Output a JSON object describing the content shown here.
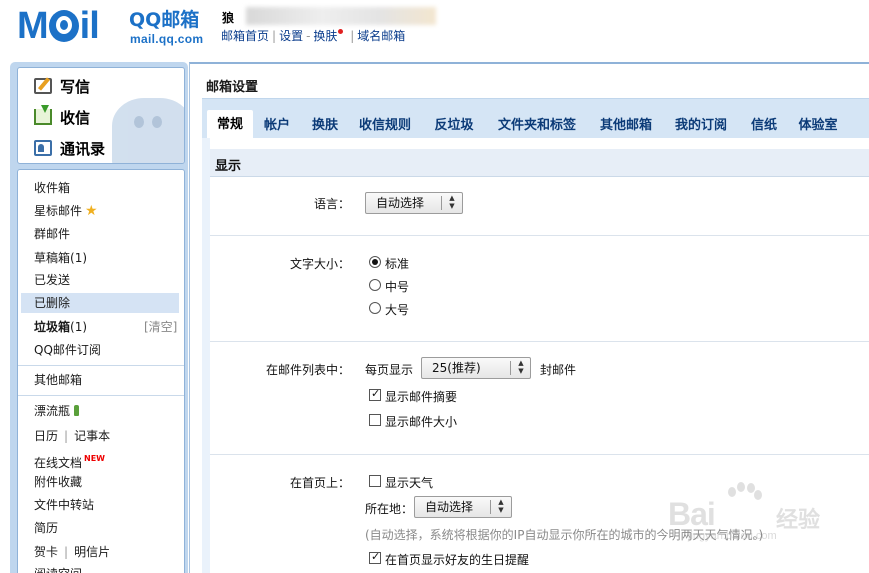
{
  "header": {
    "logo_brand": "QQ邮箱",
    "logo_domain": "mail.qq.com",
    "user_name": "狼",
    "links": {
      "home": "邮箱首页",
      "settings": "设置",
      "skin": "换肤",
      "domain": "域名邮箱"
    }
  },
  "left": {
    "quick": {
      "compose": "写信",
      "inbox": "收信",
      "contacts": "通讯录"
    },
    "folders": {
      "inbox": "收件箱",
      "starred": "星标邮件",
      "group": "群邮件",
      "drafts": "草稿箱",
      "drafts_count": "(1)",
      "sent": "已发送",
      "deleted": "已删除",
      "spam": "垃圾箱",
      "spam_count": "(1)",
      "spam_clear": "[清空]",
      "subscription": "QQ邮件订阅",
      "other_mailbox": "其他邮箱",
      "drift_bottle": "漂流瓶",
      "calendar": "日历",
      "notepad": "记事本",
      "online_docs": "在线文档",
      "new_badge": "NEW",
      "attachments": "附件收藏",
      "file_transfer": "文件中转站",
      "resume": "简历",
      "cards": "贺卡",
      "postcards": "明信片",
      "reading": "阅读空间"
    }
  },
  "main": {
    "title": "邮箱设置",
    "tabs": [
      "常规",
      "帐户",
      "换肤",
      "收信规则",
      "反垃圾",
      "文件夹和标签",
      "其他邮箱",
      "我的订阅",
      "信纸",
      "体验室"
    ],
    "active_tab": 0,
    "section_title": "显示",
    "language": {
      "label": "语言：",
      "selected": "自动选择"
    },
    "font_size": {
      "label": "文字大小：",
      "options": [
        "标准",
        "中号",
        "大号"
      ],
      "selected_index": 0
    },
    "mail_list": {
      "label": "在邮件列表中：",
      "per_page_prefix": "每页显示",
      "per_page_selected": "25(推荐)",
      "per_page_suffix": "封邮件",
      "show_summary": "显示邮件摘要",
      "show_summary_checked": true,
      "show_size": "显示邮件大小",
      "show_size_checked": false
    },
    "homepage": {
      "label": "在首页上：",
      "show_weather": "显示天气",
      "show_weather_checked": false,
      "location_label": "所在地：",
      "location_selected": "自动选择",
      "hint": "(自动选择，系统将根据你的IP自动显示你所在的城市的今明两天天气情况。)",
      "birthday": "在首页显示好友的生日提醒",
      "birthday_checked": true
    }
  },
  "watermark": {
    "brand": "Bai",
    "brand_cn": "经验",
    "url": "jingyan.baidu.com"
  }
}
